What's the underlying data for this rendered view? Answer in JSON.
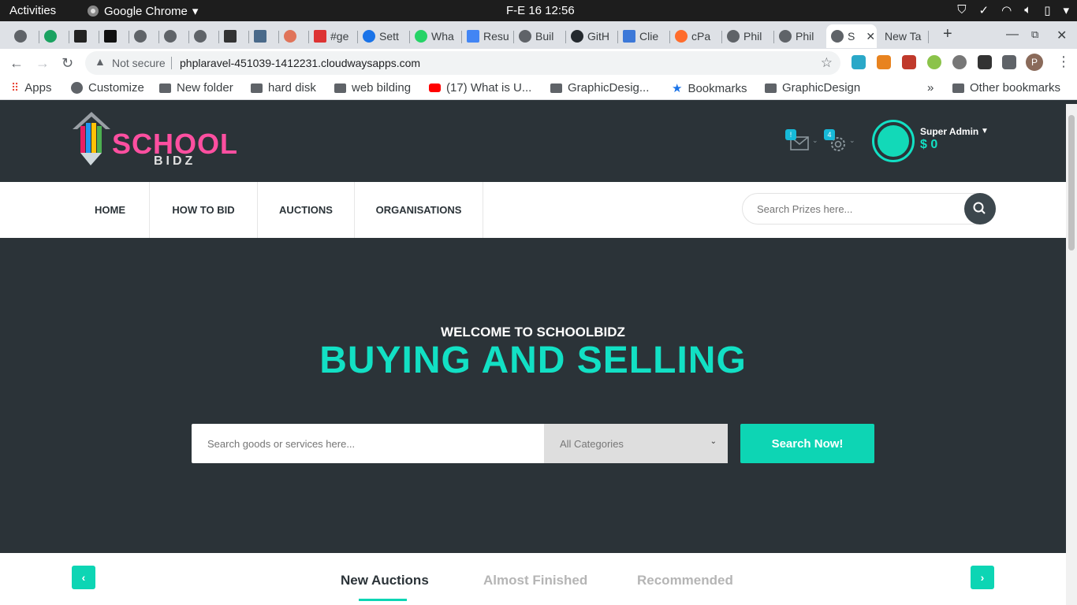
{
  "system": {
    "activities": "Activities",
    "app_name": "Google Chrome",
    "clock": "F-E 16  12:56"
  },
  "browser": {
    "tabs": [
      {
        "label": ""
      },
      {
        "label": ""
      },
      {
        "label": ""
      },
      {
        "label": ""
      },
      {
        "label": ""
      },
      {
        "label": ""
      },
      {
        "label": ""
      },
      {
        "label": ""
      },
      {
        "label": ""
      },
      {
        "label": ""
      },
      {
        "label": "#ge"
      },
      {
        "label": "Sett"
      },
      {
        "label": "Wha"
      },
      {
        "label": "Resu"
      },
      {
        "label": "Buil"
      },
      {
        "label": "GitH"
      },
      {
        "label": "Clie"
      },
      {
        "label": "cPa"
      },
      {
        "label": "Phil"
      },
      {
        "label": "Phil"
      },
      {
        "label": "S"
      },
      {
        "label": "New Ta"
      }
    ],
    "security_label": "Not secure",
    "url": "phplaravel-451039-1412231.cloudwaysapps.com",
    "profile_initial": "P",
    "bookmarks": [
      {
        "label": "Apps"
      },
      {
        "label": "Customize"
      },
      {
        "label": "New folder"
      },
      {
        "label": "hard  disk"
      },
      {
        "label": "web bilding"
      },
      {
        "label": "(17) What is U..."
      },
      {
        "label": "GraphicDesig..."
      },
      {
        "label": "Bookmarks"
      },
      {
        "label": "GraphicDesign"
      },
      {
        "label": "Other bookmarks"
      }
    ],
    "overflow": "»"
  },
  "site": {
    "logo": {
      "school": "SCHOOL",
      "bidz": "BIDZ"
    },
    "header": {
      "messages_badge": "!",
      "settings_badge": "4",
      "user_name": "Super Admin",
      "balance": "$ 0"
    },
    "nav": [
      {
        "label": "HOME"
      },
      {
        "label": "HOW TO BID"
      },
      {
        "label": "AUCTIONS"
      },
      {
        "label": "ORGANISATIONS"
      }
    ],
    "search": {
      "placeholder": "Search Prizes here..."
    },
    "hero": {
      "subtitle": "WELCOME TO SCHOOLBIDZ",
      "title": "BUYING AND SELLING",
      "search_placeholder": "Search goods or services here...",
      "category_value": "All Categories",
      "button": "Search Now!"
    },
    "auction_tabs": [
      {
        "label": "New Auctions",
        "active": true
      },
      {
        "label": "Almost Finished",
        "active": false
      },
      {
        "label": "Recommended",
        "active": false
      }
    ]
  },
  "colors": {
    "accent": "#0dd5b4",
    "dark": "#2b3338"
  }
}
